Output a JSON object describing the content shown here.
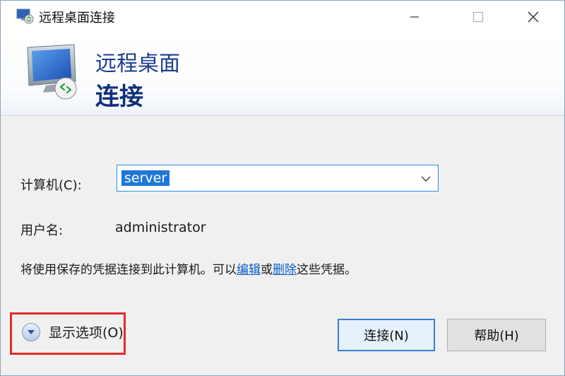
{
  "window": {
    "title": "远程桌面连接",
    "controls": {
      "minimize_icon": "minimize-icon",
      "maximize_icon": "maximize-icon",
      "close_icon": "close-icon"
    }
  },
  "banner": {
    "line1": "远程桌面",
    "line2": "连接"
  },
  "form": {
    "computer_label": "计算机(C):",
    "computer_value": "server",
    "username_label": "用户名:",
    "username_value": "administrator",
    "credentials_prefix": "将使用保存的凭据连接到此计算机。可以",
    "credentials_edit_link": "编辑",
    "credentials_or": "或",
    "credentials_delete_link": "删除",
    "credentials_suffix": "这些凭据。"
  },
  "footer": {
    "show_options_label": "显示选项(O)",
    "connect_label": "连接(N)",
    "help_label": "帮助(H)"
  },
  "colors": {
    "accent": "#1f77d8",
    "banner_text": "#1e3d8f",
    "highlight": "#e32a2a",
    "link": "#0b5fc4"
  }
}
